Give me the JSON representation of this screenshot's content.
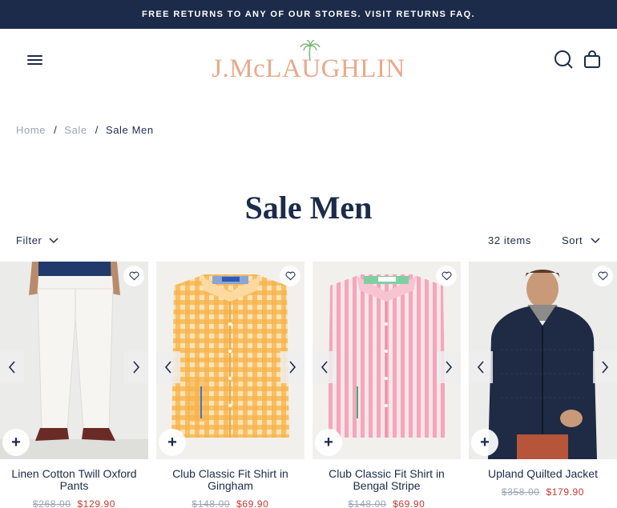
{
  "promo": {
    "text": "FREE RETURNS TO ANY OF OUR STORES. VISIT RETURNS FAQ."
  },
  "header": {
    "logo_text": "J.McLAUGHLIN"
  },
  "breadcrumb": {
    "items": [
      "Home",
      "Sale",
      "Sale Men"
    ],
    "separator": "/"
  },
  "page": {
    "title": "Sale Men"
  },
  "toolbar": {
    "filter_label": "Filter",
    "count_label": "32 items",
    "sort_label": "Sort"
  },
  "colors": {
    "navy": "#1c2b4a",
    "sale_red": "#c8372d",
    "muted": "#9aa3b5",
    "logo_peach": "#e9a98c",
    "logo_green": "#7fb77e"
  },
  "products": [
    {
      "name": "Linen Cotton Twill Oxford Pants",
      "was_price": "$268.00",
      "sale_price": "$129.90",
      "image": "white-pants"
    },
    {
      "name": "Club Classic Fit Shirt in Gingham",
      "was_price": "$148.00",
      "sale_price": "$69.90",
      "image": "orange-gingham-shirt"
    },
    {
      "name": "Club Classic Fit Shirt in Bengal Stripe",
      "was_price": "$148.00",
      "sale_price": "$69.90",
      "image": "pink-stripe-shirt"
    },
    {
      "name": "Upland Quilted Jacket",
      "was_price": "$358.00",
      "sale_price": "$179.90",
      "image": "quilted-jacket"
    }
  ],
  "icons": {
    "menu": "hamburger-icon",
    "search": "search-icon",
    "bag": "shopping-bag-icon",
    "filter_chevron": "chevron-down-icon",
    "sort_chevron": "chevron-down-icon",
    "wishlist": "heart-icon",
    "prev": "chevron-left-icon",
    "next": "chevron-right-icon",
    "quick_add": "plus-icon"
  }
}
